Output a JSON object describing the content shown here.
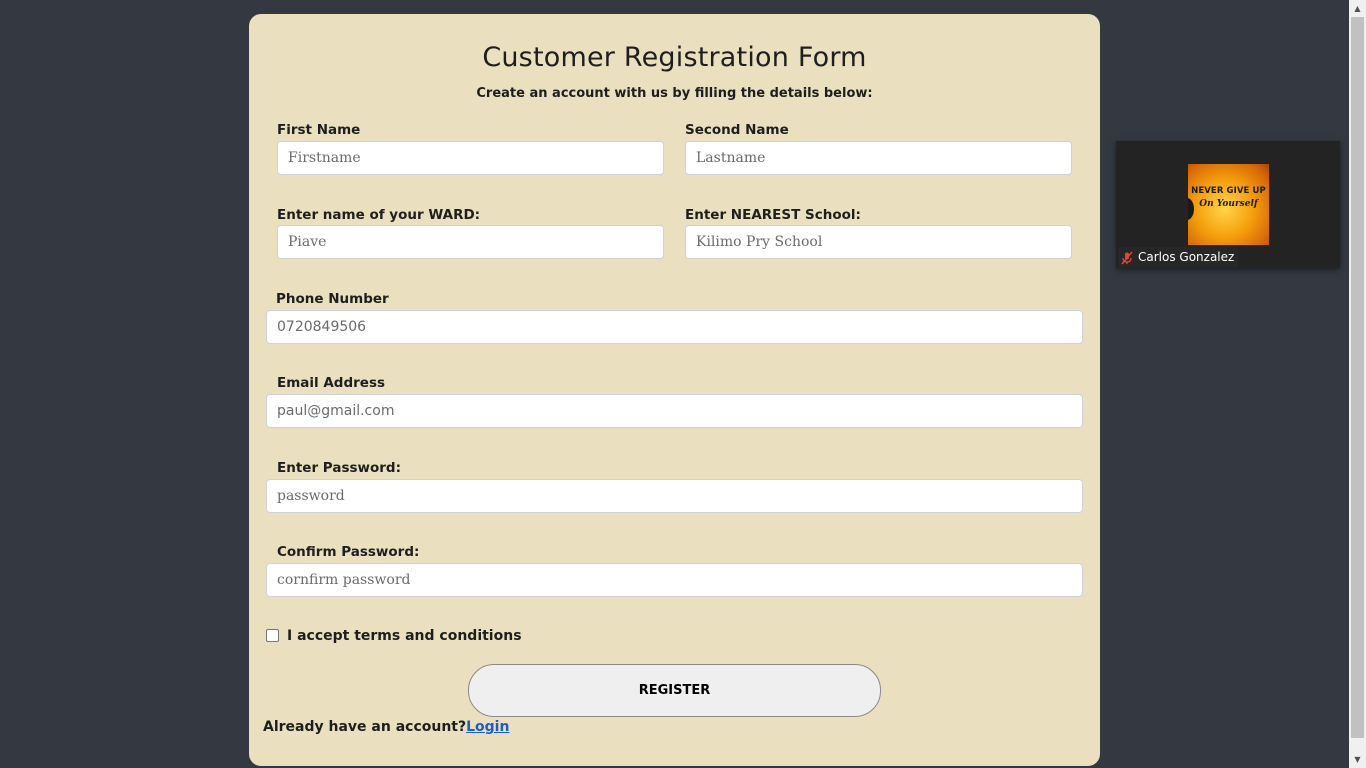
{
  "form": {
    "title": "Customer Registration Form",
    "subtitle": "Create an account with us by filling the details below:",
    "first_name": {
      "label": "First Name",
      "placeholder": "Firstname"
    },
    "second_name": {
      "label": "Second Name",
      "placeholder": "Lastname"
    },
    "ward": {
      "label": "Enter name of your WARD:",
      "placeholder": "Piave"
    },
    "school": {
      "label": "Enter NEAREST School:",
      "placeholder": "Kilimo Pry School"
    },
    "phone": {
      "label": "Phone Number",
      "placeholder": "0720849506"
    },
    "email": {
      "label": "Email Address",
      "placeholder": "paul@gmail.com"
    },
    "password": {
      "label": "Enter Password:",
      "placeholder": "password"
    },
    "confirm_password": {
      "label": "Confirm Password:",
      "placeholder": "cornfirm password"
    },
    "terms_label": "I accept terms and conditions",
    "terms_checked": false,
    "register_label": "REGISTER",
    "login_prompt": "Already have an account?",
    "login_link": "Login"
  },
  "video_tile": {
    "participant_name": "Carlos Gonzalez",
    "mic_icon": "mic-muted-icon",
    "thumbnail_line1": "NEVER GIVE UP",
    "thumbnail_line2": "On Yourself"
  },
  "colors": {
    "background": "#343941",
    "card": "#eae0bf",
    "link": "#1a5fc9",
    "mic_muted": "#e0463c"
  }
}
